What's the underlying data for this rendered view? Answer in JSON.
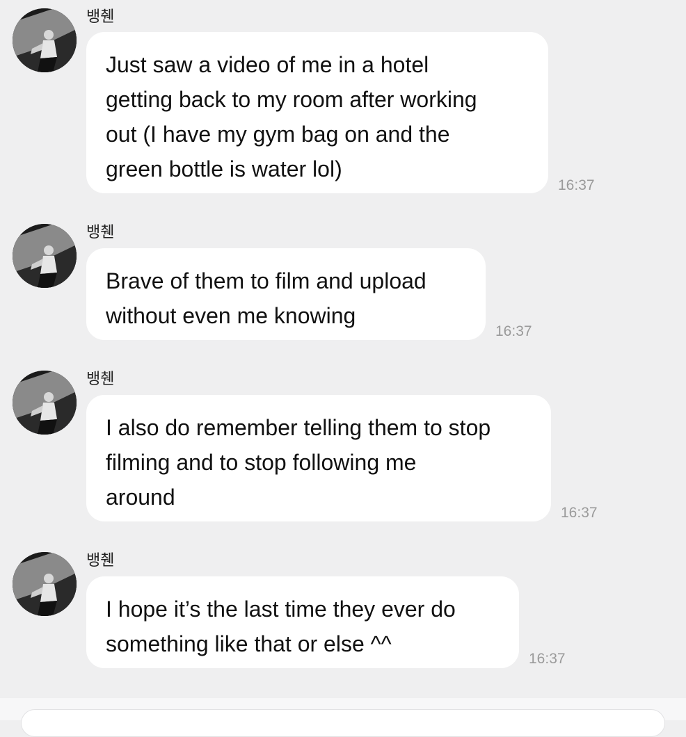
{
  "chat": {
    "messages": [
      {
        "sender": "뱅췐",
        "text": "Just saw a video of me in a hotel\ngetting back to my room after working\nout (I have my gym bag on and the\ngreen bottle is water lol)",
        "time": "16:37"
      },
      {
        "sender": "뱅췐",
        "text": "Brave of them to film and upload\nwithout even me knowing",
        "time": "16:37"
      },
      {
        "sender": "뱅췐",
        "text": "I also do remember telling them to stop\nfilming and to stop following me\naround",
        "time": "16:37"
      },
      {
        "sender": "뱅췐",
        "text": "I hope it’s the last time they ever do\nsomething like that or else ^^",
        "time": "16:37"
      }
    ]
  },
  "colors": {
    "background": "#efeff0",
    "bubble": "#ffffff",
    "timestamp": "#9a9a9a"
  },
  "icons": {
    "avatar": "profile-photo"
  }
}
